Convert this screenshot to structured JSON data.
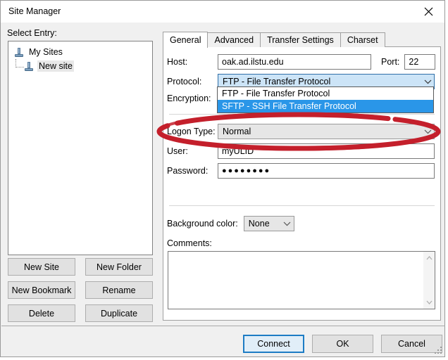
{
  "window": {
    "title": "Site Manager",
    "close_icon": "close-x-icon",
    "resize_grip": "resize-grip-icon"
  },
  "left_panel": {
    "select_entry_label": "Select Entry:",
    "tree": [
      {
        "label": "My Sites",
        "icon": "server-icon",
        "selected": false
      },
      {
        "label": "New site",
        "icon": "server-icon",
        "selected": true
      }
    ],
    "buttons": [
      {
        "label": "New Site"
      },
      {
        "label": "New Folder"
      },
      {
        "label": "New Bookmark"
      },
      {
        "label": "Rename"
      },
      {
        "label": "Delete"
      },
      {
        "label": "Duplicate"
      }
    ]
  },
  "tabs": [
    {
      "label": "General",
      "active": true
    },
    {
      "label": "Advanced",
      "active": false
    },
    {
      "label": "Transfer Settings",
      "active": false
    },
    {
      "label": "Charset",
      "active": false
    }
  ],
  "general": {
    "host_label": "Host:",
    "host_value": "oak.ad.ilstu.edu",
    "port_label": "Port:",
    "port_value": "22",
    "protocol_label": "Protocol:",
    "protocol_value": "FTP - File Transfer Protocol",
    "protocol_options": [
      {
        "label": "FTP - File Transfer Protocol",
        "selected": false
      },
      {
        "label": "SFTP - SSH File Transfer Protocol",
        "selected": true
      }
    ],
    "protocol_dropdown_open": true,
    "encryption_label": "Encryption:",
    "logon_type_label": "Logon Type:",
    "logon_type_value": "Normal",
    "user_label": "User:",
    "user_value": "myULID",
    "password_label": "Password:",
    "password_value": "●●●●●●●●",
    "background_color_label": "Background color:",
    "background_color_value": "None",
    "comments_label": "Comments:",
    "comments_value": "",
    "chevron_icon": "chevron-down-icon",
    "scroll_up_icon": "chevron-up-icon",
    "scroll_down_icon": "chevron-down-icon"
  },
  "bottom_buttons": [
    {
      "label": "Connect",
      "default": true
    },
    {
      "label": "OK",
      "default": false
    },
    {
      "label": "Cancel",
      "default": false
    }
  ],
  "annotation": {
    "shape": "red-ellipse-highlight",
    "target": "Logon Type: Normal",
    "color": "#c4202c"
  }
}
